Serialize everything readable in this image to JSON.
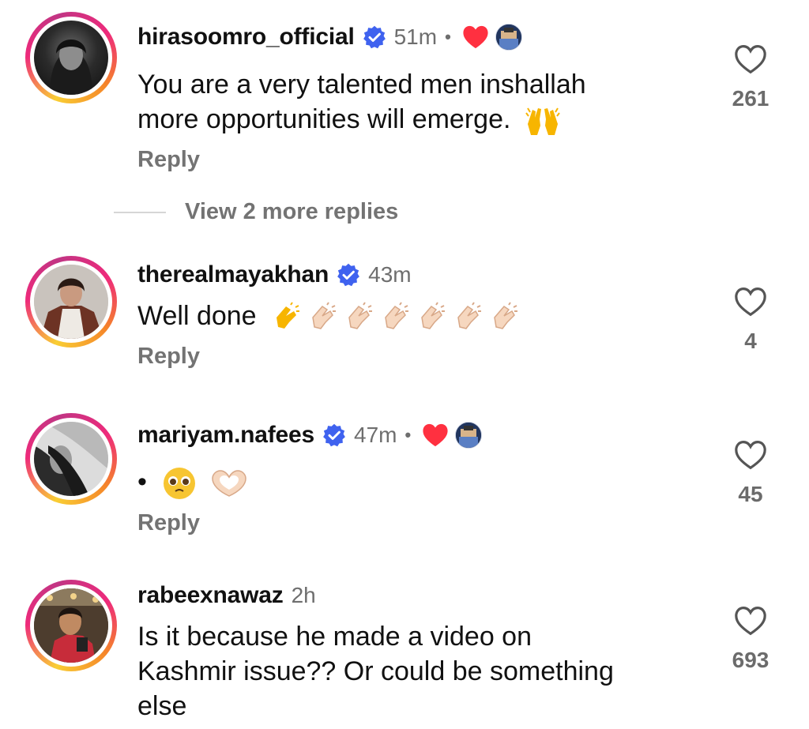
{
  "comments": [
    {
      "username": "hirasoomro_official",
      "verified": true,
      "time": "51m",
      "liked_by_creator": true,
      "text_line1": "You are a very talented men inshallah",
      "text_line2": "more opportunities will emerge.",
      "emoji": "raising-hands",
      "reply_label": "Reply",
      "like_count": "261"
    },
    {
      "username": "therealmayakhan",
      "verified": true,
      "time": "43m",
      "liked_by_creator": false,
      "text": "Well done",
      "emoji": "clapping-hands x7",
      "reply_label": "Reply",
      "like_count": "4"
    },
    {
      "username": "mariyam.nafees",
      "verified": true,
      "time": "47m",
      "liked_by_creator": true,
      "text": "•",
      "emoji": "pleading-face, heart-hands",
      "reply_label": "Reply",
      "like_count": "45"
    },
    {
      "username": "rabeexnawaz",
      "verified": false,
      "time": "2h",
      "text_line1": "Is it because he made a video on",
      "text_line2": "Kashmir issue?? Or could be something",
      "text_line3": "else",
      "like_count": "693"
    }
  ],
  "view_more_replies": "View 2 more replies",
  "separator_dot": "•",
  "colors": {
    "verified_blue": "#3f62ef",
    "liked_red": "#ff3040",
    "meta_gray": "#737373"
  }
}
